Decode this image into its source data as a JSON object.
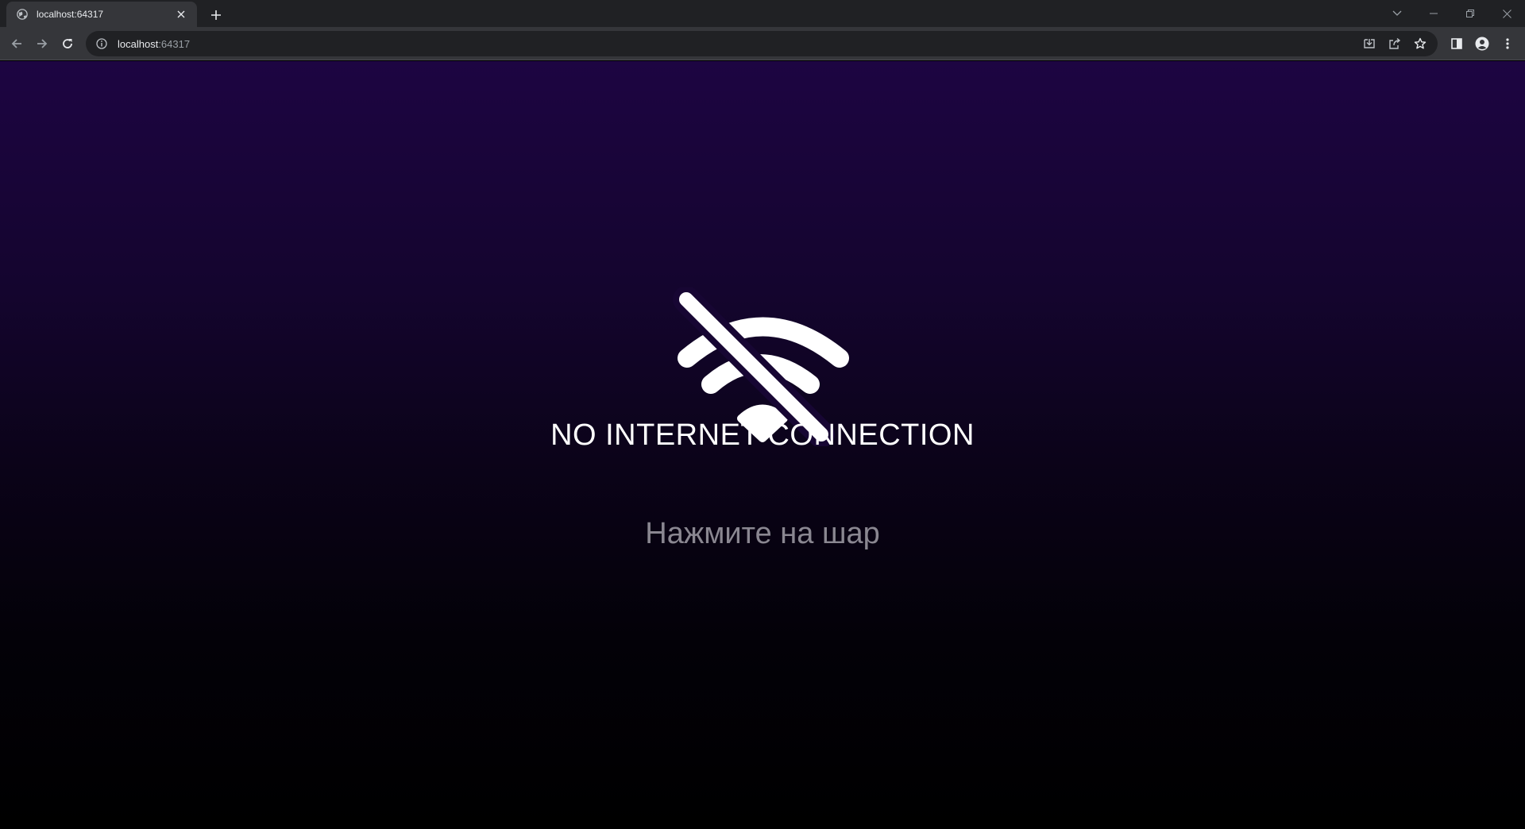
{
  "browser": {
    "tab_title": "localhost:64317",
    "url_host": "localhost",
    "url_port": ":64317"
  },
  "icons": {
    "favicon": "globe-icon",
    "tab_close": "close-icon",
    "new_tab": "plus-icon",
    "tab_search": "chevron-down-icon",
    "minimize": "minimize-icon",
    "restore": "restore-icon",
    "close_window": "close-icon",
    "back": "arrow-left-icon",
    "forward": "arrow-right-icon",
    "reload": "reload-icon",
    "site_info": "info-icon",
    "install": "install-icon",
    "share": "share-icon",
    "bookmark": "star-icon",
    "side_panel": "side-panel-icon",
    "profile": "profile-icon",
    "menu": "kebab-menu-icon",
    "status": "wifi-off-icon"
  },
  "page": {
    "headline": "NO INTERNET CONNECTION",
    "hint": "Нажмите на шар"
  },
  "colors": {
    "gradient_top": "#1d0542",
    "gradient_bottom": "#000000",
    "headline": "#ffffff",
    "hint": "#8a8791"
  }
}
